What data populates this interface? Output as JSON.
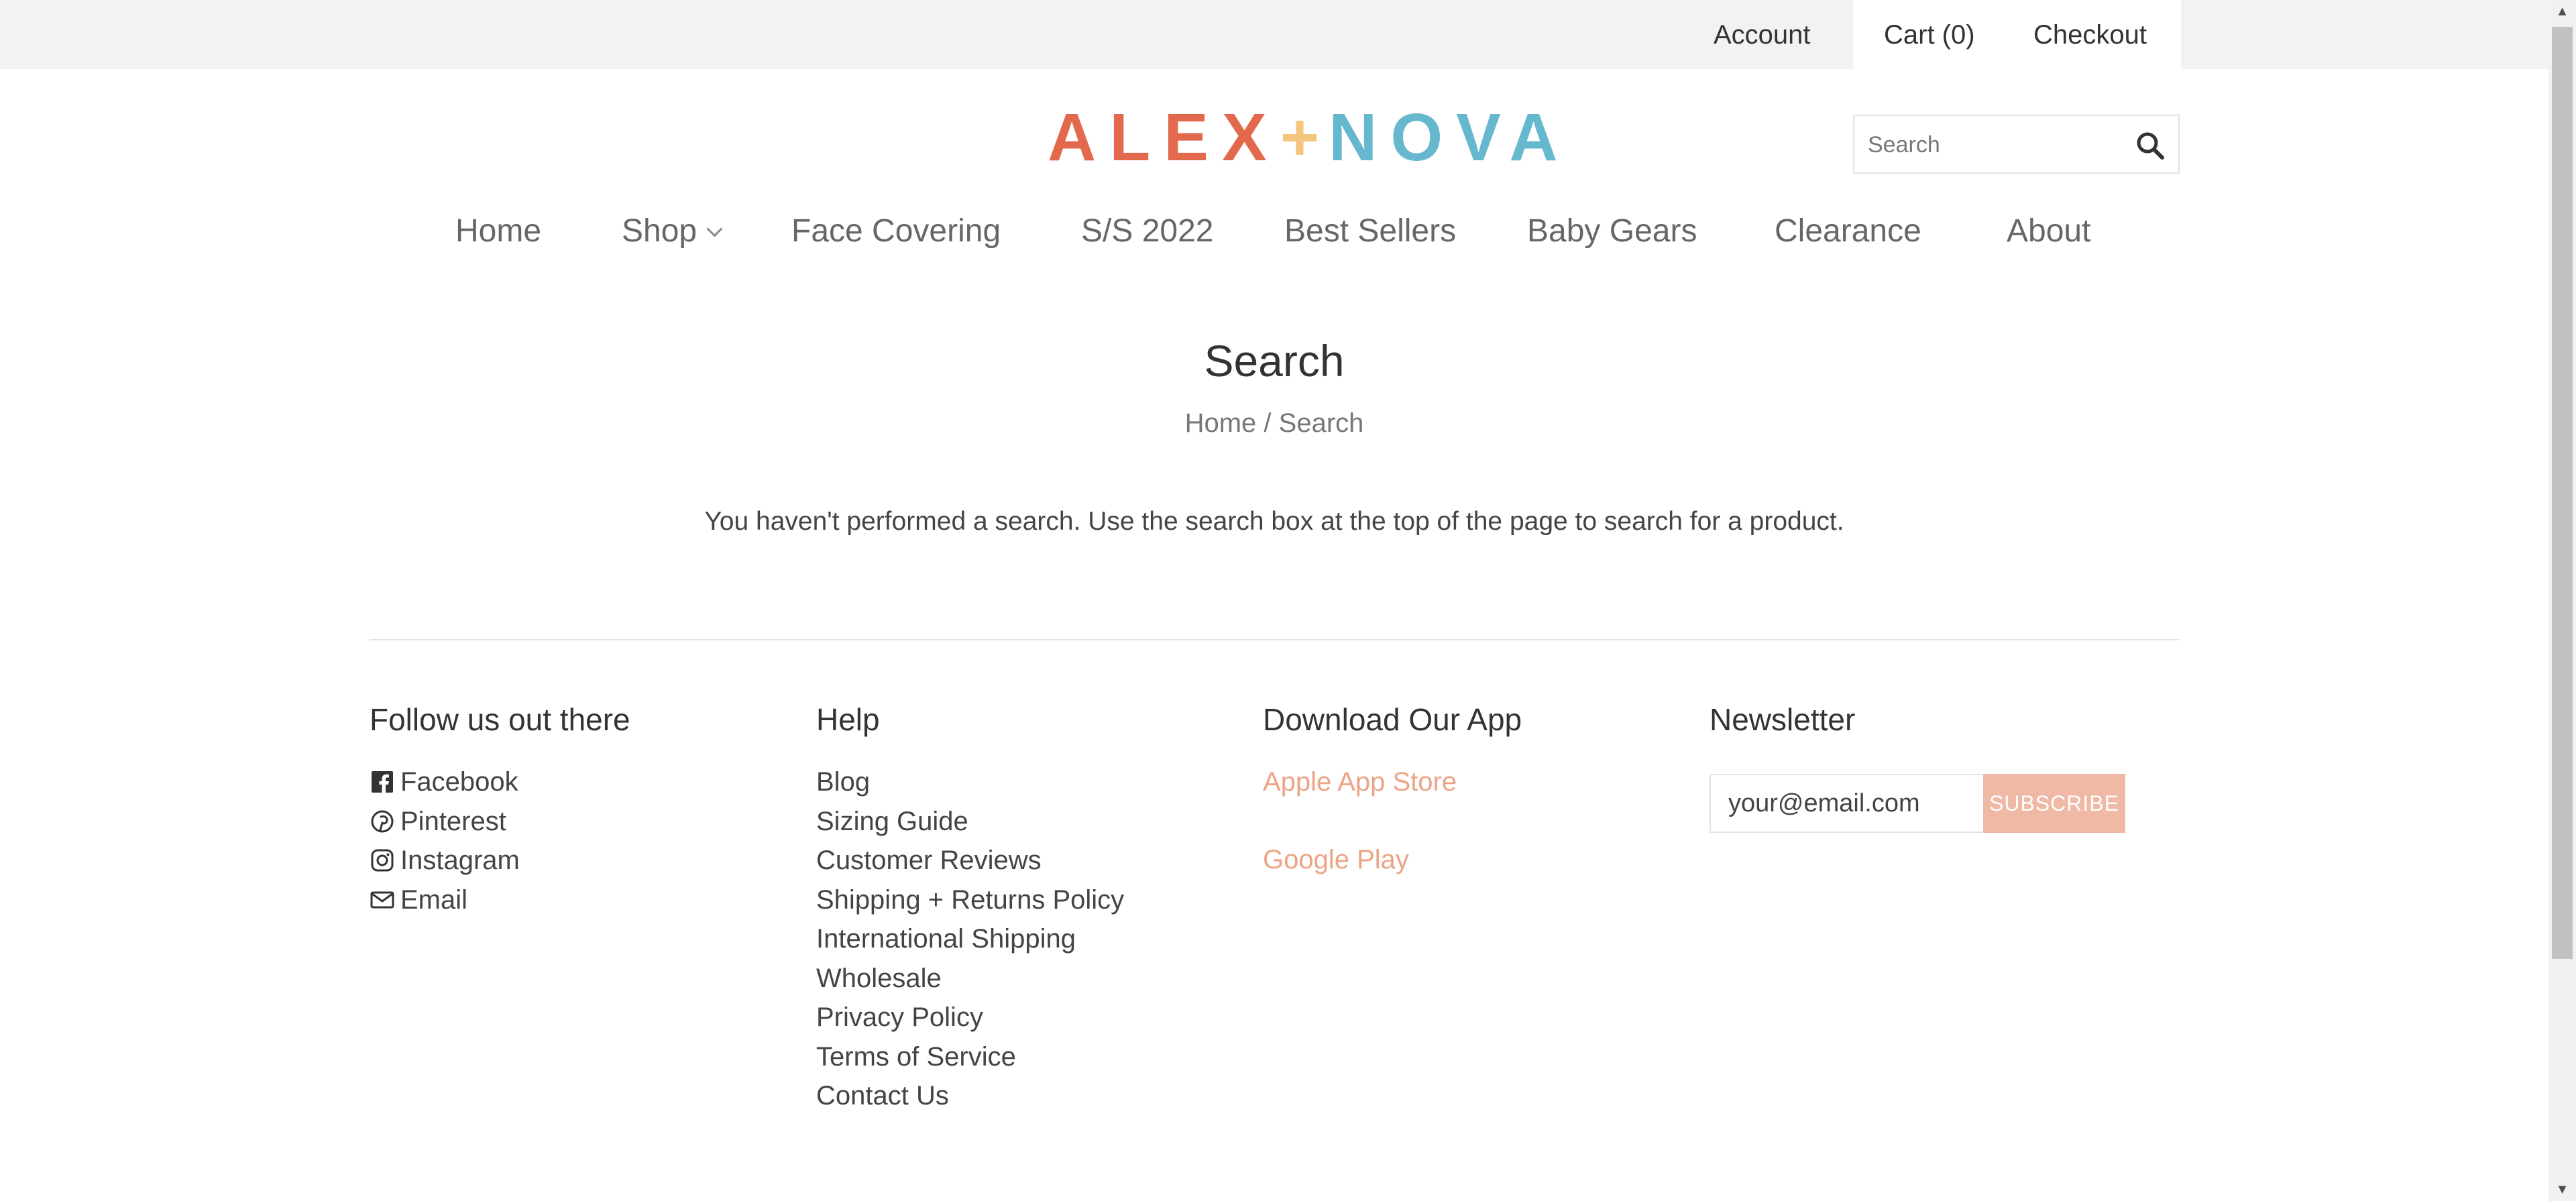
{
  "topbar": {
    "account": "Account",
    "cart": "Cart (0)",
    "checkout": "Checkout"
  },
  "logo": {
    "left": "ALEX",
    "plus": "+",
    "right": "NOVA",
    "colors": {
      "alex": "#e2694e",
      "plus": "#f4c57c",
      "nova": "#66b8cf"
    }
  },
  "search": {
    "placeholder": "Search",
    "icon": "search-icon"
  },
  "nav": {
    "items": [
      "Home",
      "Shop",
      "Face Covering",
      "S/S 2022",
      "Best Sellers",
      "Baby Gears",
      "Clearance",
      "About"
    ]
  },
  "page": {
    "title": "Search",
    "breadcrumb": {
      "home": "Home",
      "separator": "/",
      "current": "Search"
    },
    "message": "You haven't performed a search. Use the search box at the top of the page to search for a product."
  },
  "footer": {
    "social": {
      "heading": "Follow us out there",
      "links": [
        {
          "label": "Facebook",
          "icon": "facebook-icon"
        },
        {
          "label": "Pinterest",
          "icon": "pinterest-icon"
        },
        {
          "label": "Instagram",
          "icon": "instagram-icon"
        },
        {
          "label": "Email",
          "icon": "email-icon"
        }
      ]
    },
    "help": {
      "heading": "Help",
      "links": [
        "Blog",
        "Sizing Guide",
        "Customer Reviews",
        "Shipping + Returns Policy",
        "International Shipping",
        "Wholesale",
        "Privacy Policy",
        "Terms of Service",
        "Contact Us"
      ]
    },
    "app": {
      "heading": "Download Our App",
      "apple": "Apple App Store",
      "google": "Google Play",
      "link_color": "#eba586"
    },
    "newsletter": {
      "heading": "Newsletter",
      "placeholder": "your@email.com",
      "button": "SUBSCRIBE",
      "button_color": "#f0b9a6"
    }
  }
}
